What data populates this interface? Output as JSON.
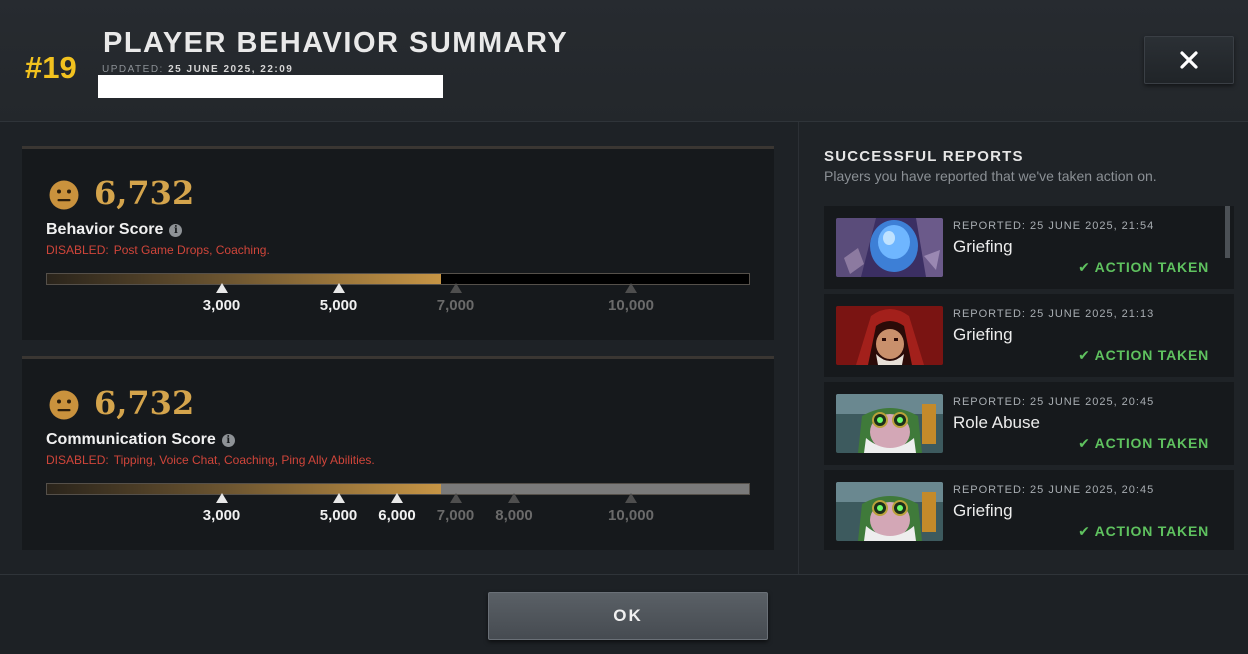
{
  "header": {
    "rank": "#19",
    "title": "PLAYER BEHAVIOR SUMMARY",
    "updated_label": "UPDATED:",
    "updated_value": "25 JUNE 2025, 22:09",
    "close_icon": "close-icon"
  },
  "behavior": {
    "score": "6,732",
    "label": "Behavior Score",
    "disabled_label": "DISABLED:",
    "disabled_items": "Post Game Drops, Coaching.",
    "value": 6732,
    "bar_max": 12000,
    "ticks": [
      {
        "value": 3000,
        "label": "3,000",
        "reached": true
      },
      {
        "value": 5000,
        "label": "5,000",
        "reached": true
      },
      {
        "value": 7000,
        "label": "7,000",
        "reached": false
      },
      {
        "value": 10000,
        "label": "10,000",
        "reached": false
      }
    ],
    "rest_color": "#000000"
  },
  "communication": {
    "score": "6,732",
    "label": "Communication Score",
    "disabled_label": "DISABLED:",
    "disabled_items": "Tipping, Voice Chat, Coaching, Ping Ally Abilities.",
    "value": 6732,
    "bar_max": 12000,
    "ticks": [
      {
        "value": 3000,
        "label": "3,000",
        "reached": true
      },
      {
        "value": 5000,
        "label": "5,000",
        "reached": true
      },
      {
        "value": 6000,
        "label": "6,000",
        "reached": true
      },
      {
        "value": 7000,
        "label": "7,000",
        "reached": false
      },
      {
        "value": 8000,
        "label": "8,000",
        "reached": false
      },
      {
        "value": 10000,
        "label": "10,000",
        "reached": false
      }
    ],
    "rest_color": "#7a7a7a"
  },
  "reports": {
    "title": "SUCCESSFUL REPORTS",
    "subtitle": "Players you have reported that we've taken action on.",
    "items": [
      {
        "date": "REPORTED: 25 JUNE 2025, 21:54",
        "reason": "Griefing",
        "status": "ACTION TAKEN",
        "hero_icon": "arc-warden-portrait"
      },
      {
        "date": "REPORTED: 25 JUNE 2025, 21:13",
        "reason": "Griefing",
        "status": "ACTION TAKEN",
        "hero_icon": "bounty-hunter-portrait"
      },
      {
        "date": "REPORTED: 25 JUNE 2025, 20:45",
        "reason": "Role Abuse",
        "status": "ACTION TAKEN",
        "hero_icon": "sniper-portrait"
      },
      {
        "date": "REPORTED: 25 JUNE 2025, 20:45",
        "reason": "Griefing",
        "status": "ACTION TAKEN",
        "hero_icon": "sniper-portrait"
      }
    ]
  },
  "footer": {
    "ok_label": "OK"
  },
  "colors": {
    "rank": "#f2c21f",
    "score": "#d4a44c",
    "disabled": "#d0453a",
    "action_taken": "#5fc25f"
  }
}
